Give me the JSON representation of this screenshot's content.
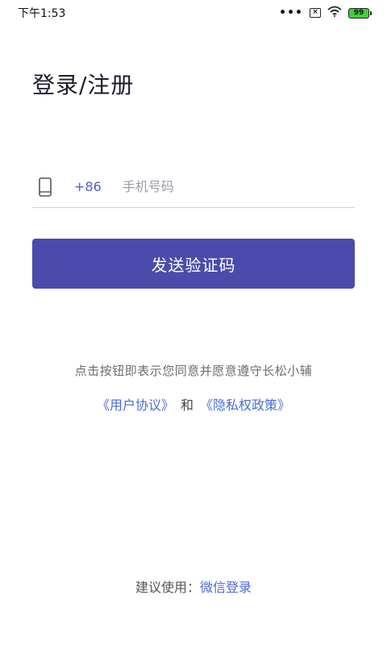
{
  "status_bar": {
    "time": "下午1:53",
    "dots": "•••",
    "battery": "99"
  },
  "page": {
    "title": "登录/注册"
  },
  "phone": {
    "country_code": "+86",
    "placeholder": "手机号码",
    "value": ""
  },
  "actions": {
    "send_code_label": "发送验证码"
  },
  "agreement": {
    "text": "点击按钮即表示您同意并愿意遵守长松小辅",
    "user_agreement": "《用户协议》",
    "and": "和",
    "privacy_policy": "《隐私权政策》"
  },
  "footer": {
    "suggest_label": "建议使用：",
    "wechat_login": "微信登录"
  },
  "colors": {
    "accent": "#4b4bab",
    "link": "#4a6ad6"
  }
}
